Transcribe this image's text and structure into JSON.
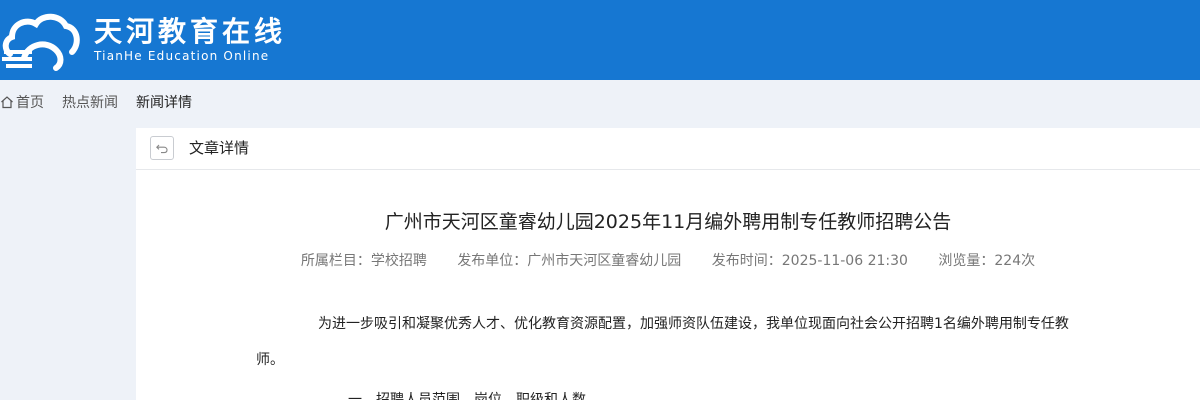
{
  "header": {
    "title_cn": "天河教育在线",
    "title_en": "TianHe Education Online",
    "bg_color": "#1677d2"
  },
  "breadcrumb": {
    "home_icon": "home-icon",
    "items": [
      "首页",
      "热点新闻",
      "新闻详情"
    ]
  },
  "panel": {
    "back_icon": "undo-icon",
    "title": "文章详情"
  },
  "article": {
    "title": "广州市天河区童睿幼儿园2025年11月编外聘用制专任教师招聘公告",
    "meta": {
      "category": "所属栏目：学校招聘",
      "publisher": "发布单位：广州市天河区童睿幼儿园",
      "time": "发布时间：2025-11-06 21:30",
      "views": "浏览量：224次"
    },
    "paragraph1": "为进一步吸引和凝聚优秀人才、优化教育资源配置，加强师资队伍建设，我单位现面向社会公开招聘1名编外聘用制专任教师。",
    "paragraph2": "一、招聘人员范围、岗位、职级和人数"
  }
}
